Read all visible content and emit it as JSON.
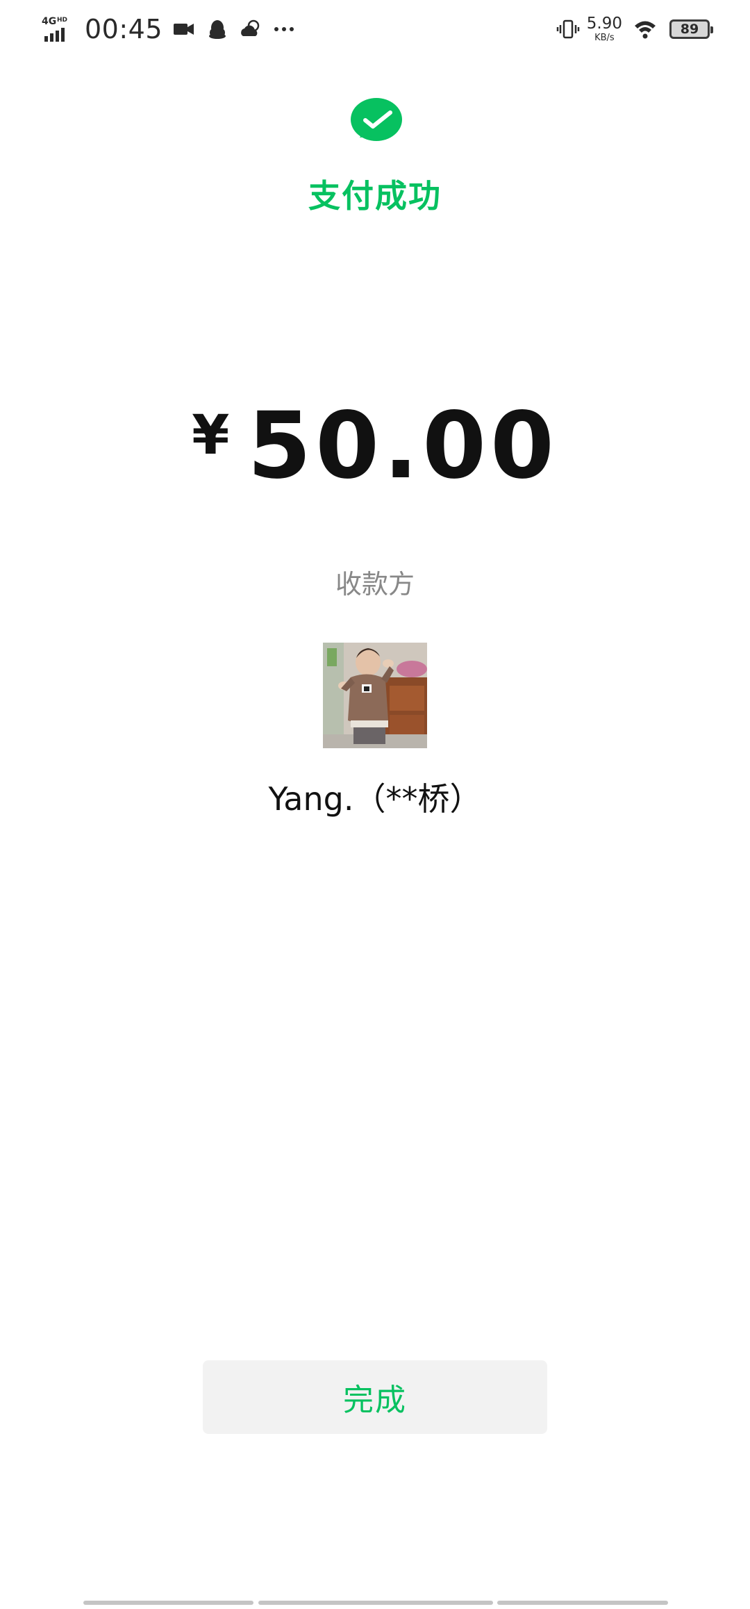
{
  "status_bar": {
    "network_type": "4GHD",
    "time": "00:45",
    "net_speed_value": "5.90",
    "net_speed_unit": "KB/s",
    "battery_level": "89",
    "left_icons": [
      "video-icon",
      "qq-penguin-icon",
      "weather-cloud-icon",
      "more-dots-icon"
    ],
    "right_icons": [
      "vibrate-icon",
      "wifi-icon",
      "battery-icon"
    ]
  },
  "payment_result": {
    "status_icon": "wechat-pay-success-icon",
    "title": "支付成功",
    "currency_symbol": "¥",
    "amount": "50.00",
    "payee_label": "收款方",
    "payee_name": "Yang.（**桥）",
    "payee_avatar": "child-photo-avatar"
  },
  "actions": {
    "done_label": "完成"
  },
  "colors": {
    "accent": "#07c160",
    "muted_text": "#888888",
    "button_bg": "#f2f2f2"
  }
}
